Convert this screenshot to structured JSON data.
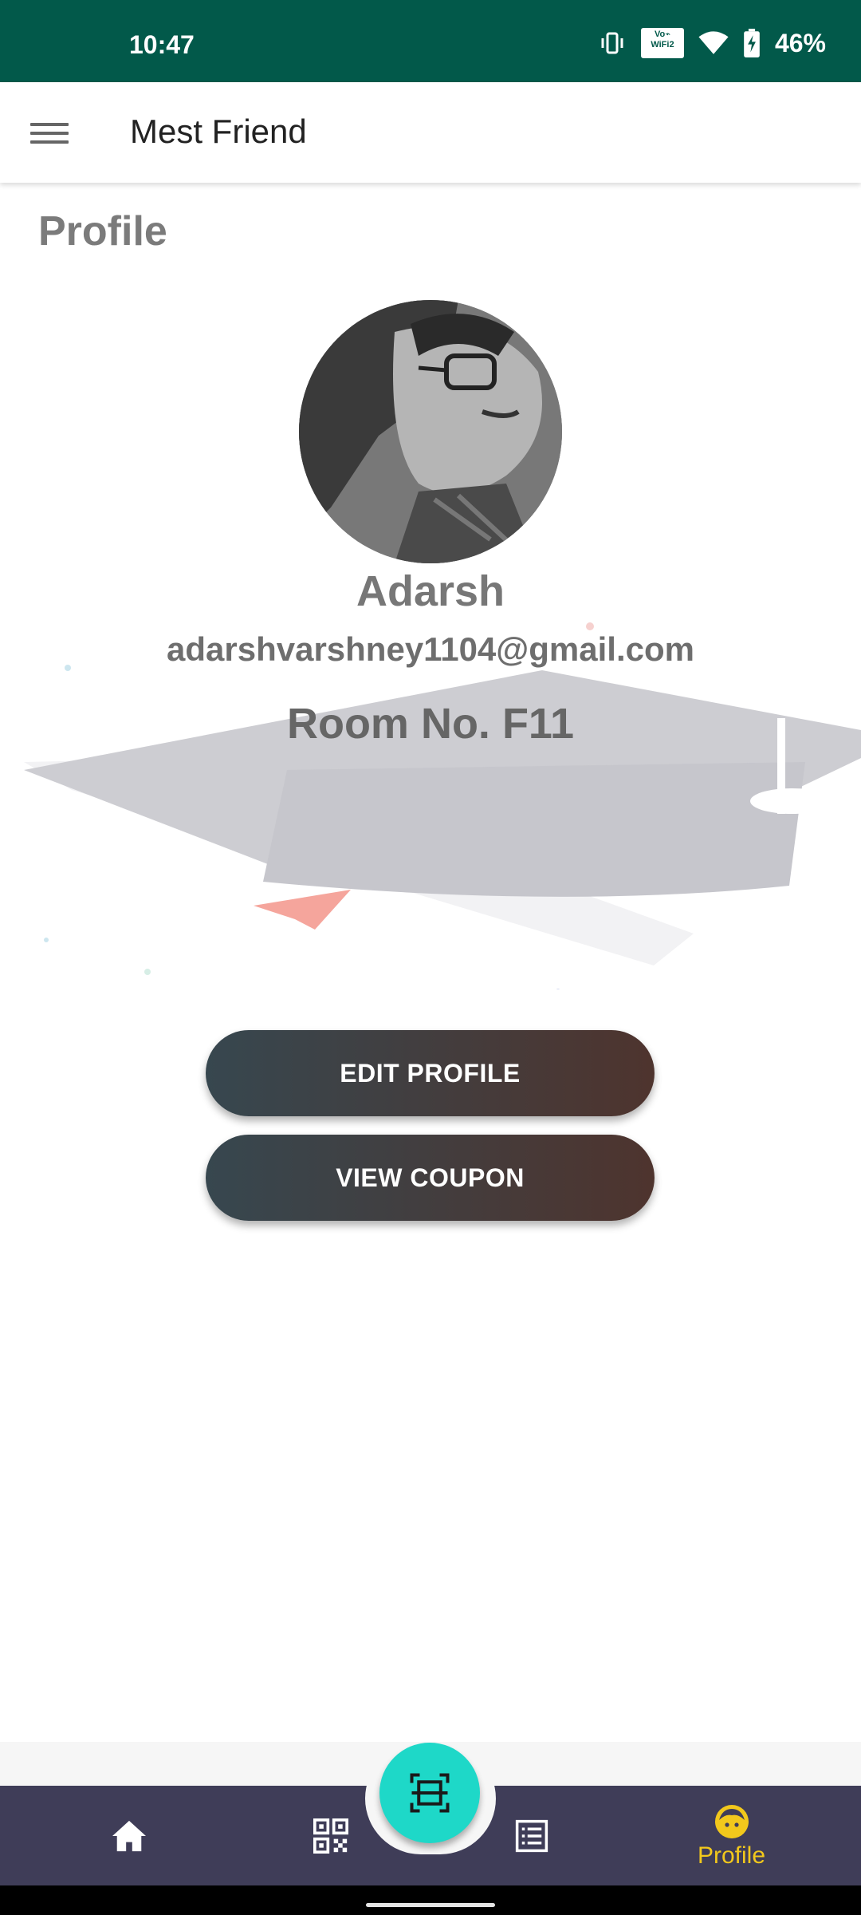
{
  "status_bar": {
    "time": "10:47",
    "battery_percent": "46%",
    "icons": [
      "vibrate-icon",
      "vowifi-icon",
      "wifi-icon",
      "battery-charging-icon"
    ],
    "vowifi_label": "VoWiFi 2"
  },
  "app_bar": {
    "title": "Mest Friend",
    "menu_icon": "hamburger-menu-icon"
  },
  "page": {
    "title": "Profile"
  },
  "profile": {
    "name": "Adarsh",
    "email": "adarshvarshney1104@gmail.com",
    "room": "Room No. F11"
  },
  "actions": {
    "edit_profile": "EDIT PROFILE",
    "view_coupon": "VIEW COUPON"
  },
  "bottom_nav": {
    "items": [
      {
        "icon": "home-icon",
        "label": ""
      },
      {
        "icon": "qr-code-icon",
        "label": ""
      },
      {
        "icon": "list-icon",
        "label": ""
      },
      {
        "icon": "face-icon",
        "label": "Profile",
        "active": true
      }
    ],
    "fab_icon": "scan-icon",
    "background_color": "#3f3d58",
    "active_color": "#f2c81c",
    "fab_color": "#1ed8c8"
  }
}
